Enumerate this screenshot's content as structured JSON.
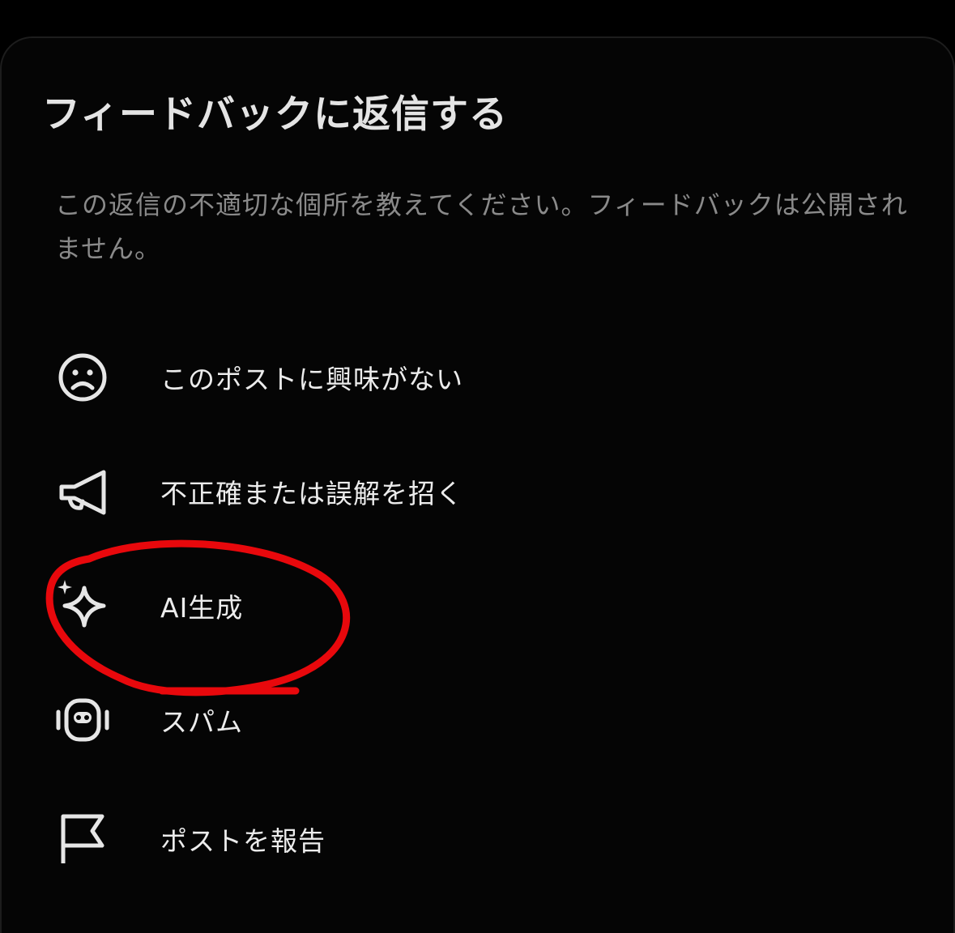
{
  "dialog": {
    "title": "フィードバックに返信する",
    "description": "この返信の不適切な個所を教えてください。フィードバックは公開されません。"
  },
  "options": [
    {
      "label": "このポストに興味がない",
      "icon": "sad-face-icon"
    },
    {
      "label": "不正確または誤解を招く",
      "icon": "megaphone-icon"
    },
    {
      "label": "AI生成",
      "icon": "sparkle-icon"
    },
    {
      "label": "スパム",
      "icon": "robot-icon"
    },
    {
      "label": "ポストを報告",
      "icon": "flag-icon"
    }
  ],
  "colors": {
    "background": "#000000",
    "title": "#e4e4e4",
    "description": "#8a8a8a",
    "option_text": "#ececec",
    "annotation": "#e8080c"
  }
}
